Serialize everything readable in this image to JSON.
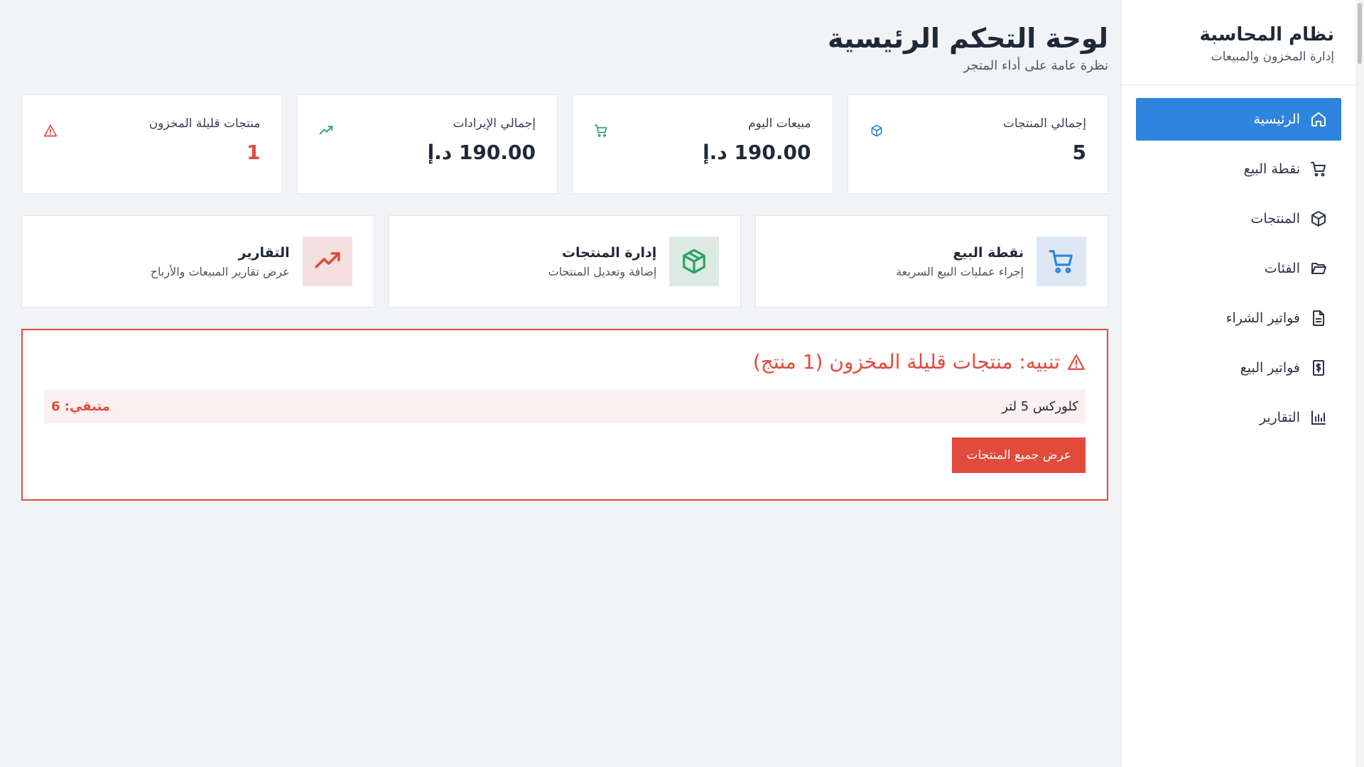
{
  "sidebar": {
    "title": "نظام المحاسبة",
    "subtitle": "إدارة المخزون والمبيعات",
    "items": [
      {
        "label": "الرئيسية",
        "icon": "home-icon",
        "active": true
      },
      {
        "label": "نقطة البيع",
        "icon": "cart-icon"
      },
      {
        "label": "المنتجات",
        "icon": "box-icon"
      },
      {
        "label": "الفئات",
        "icon": "folder-icon"
      },
      {
        "label": "فواتير الشراء",
        "icon": "document-icon"
      },
      {
        "label": "فواتير البيع",
        "icon": "dollar-document-icon"
      },
      {
        "label": "التقارير",
        "icon": "bar-chart-icon"
      }
    ]
  },
  "header": {
    "title": "لوحة التحكم الرئيسية",
    "subtitle": "نظرة عامة على أداء المتجر"
  },
  "stats": [
    {
      "label": "إجمالي المنتجات",
      "value": "5",
      "icon": "box-icon",
      "color": "#2f84dd"
    },
    {
      "label": "مبيعات اليوم",
      "value": "190.00 د.إ",
      "icon": "cart-icon",
      "color": "#27a460"
    },
    {
      "label": "إجمالي الإيرادات",
      "value": "190.00 د.إ",
      "icon": "trending-up-icon",
      "color": "#27a460"
    },
    {
      "label": "منتجات قليلة المخزون",
      "value": "1",
      "icon": "warning-icon",
      "color": "#e24a3b"
    }
  ],
  "quick_actions": [
    {
      "title": "نقطة البيع",
      "desc": "إجراء عمليات البيع السريعة",
      "icon": "cart-icon",
      "color": "#2f84dd"
    },
    {
      "title": "إدارة المنتجات",
      "desc": "إضافة وتعديل المنتجات",
      "icon": "box-icon",
      "color": "#27a460"
    },
    {
      "title": "التقارير",
      "desc": "عرض تقارير المبيعات والأرباح",
      "icon": "trending-up-icon",
      "color": "#e24a3b"
    }
  ],
  "alert": {
    "title": "تنبيه: منتجات قليلة المخزون (1 منتج)",
    "items": [
      {
        "name": "كلوركس 5 لتر",
        "remaining": "متبقي: 6"
      }
    ],
    "button": "عرض جميع المنتجات",
    "accent": "#e24a3b"
  }
}
